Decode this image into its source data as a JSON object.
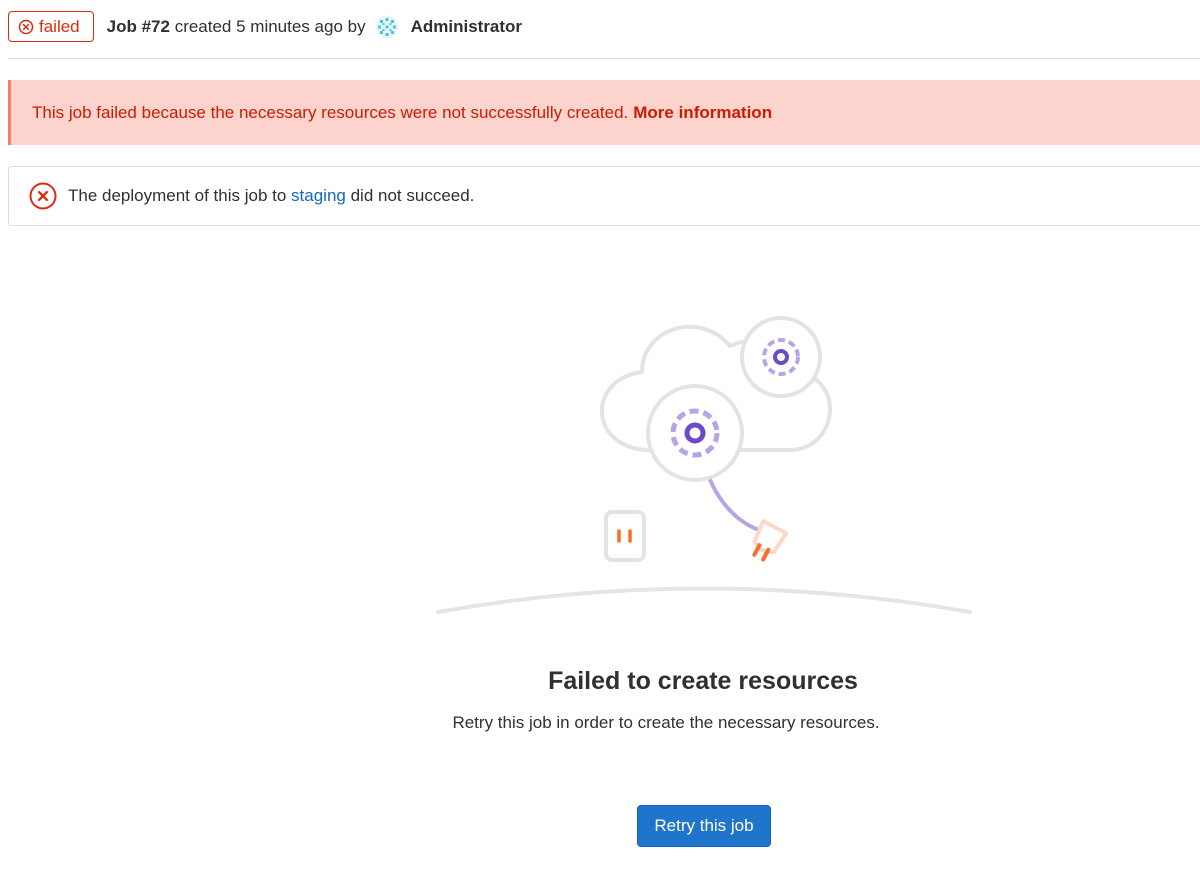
{
  "header": {
    "status_label": "failed",
    "job_id": "Job #72",
    "created_text": "created 5 minutes ago by",
    "author": "Administrator"
  },
  "alert": {
    "message": "This job failed because the necessary resources were not successfully created.",
    "link_text": "More information"
  },
  "deployment": {
    "prefix": "The deployment of this job to",
    "environment": "staging",
    "suffix": "did not succeed."
  },
  "empty_state": {
    "title": "Failed to create resources",
    "description": "Retry this job in order to create the necessary resources.",
    "button_label": "Retry this job"
  },
  "icons": {
    "status": "status-failed-icon",
    "deploy_error": "error-circle-icon",
    "avatar": "identicon-avatar",
    "illustration": "cloud-gears-plug-illustration"
  },
  "colors": {
    "danger": "#dd2b0e",
    "alert_bg": "#fdd4cd",
    "alert_text": "#c91c00",
    "link": "#1068bf",
    "primary": "#1f75cb",
    "illustration_purple": "#6e49cb",
    "illustration_orange": "#fc6d26"
  }
}
